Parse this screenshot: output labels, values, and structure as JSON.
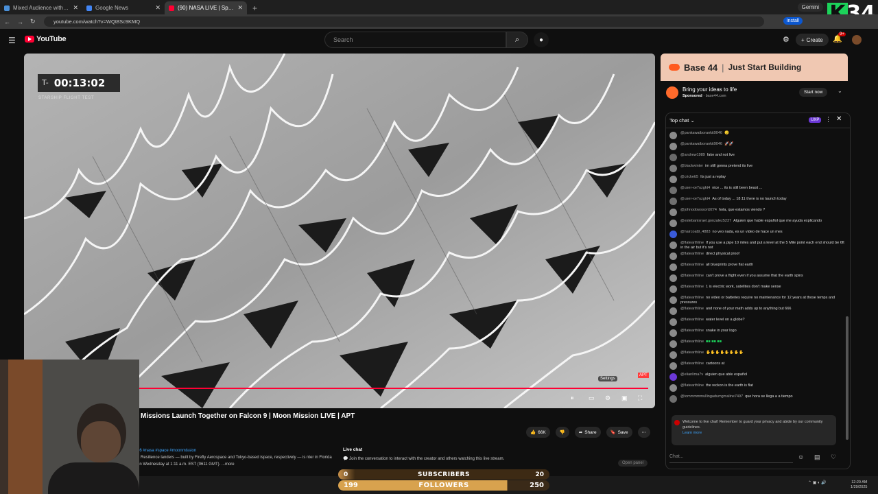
{
  "browser": {
    "tabs": [
      {
        "label": "Mixed Audience with Kathy Hu",
        "color": "#4a90d9",
        "active": false
      },
      {
        "label": "Google News",
        "color": "#4285f4",
        "active": false
      },
      {
        "label": "(90) NASA LIVE | SpaceX LIVE",
        "color": "#ff0033",
        "active": true
      }
    ],
    "new_tab": "+",
    "url": "youtube.com/watch?v=WQt8Sc9KMQ",
    "install_label": "Install",
    "gemini_label": "Gemini"
  },
  "overlay": {
    "k_letter": "K",
    "k_count": "34",
    "subscribers_label": "SUBSCRIBERS",
    "subscribers_current": "0",
    "subscribers_goal": "20",
    "followers_label": "FOLLOWERS",
    "followers_current": "199",
    "followers_goal": "250",
    "followers_progress": 0.796
  },
  "youtube": {
    "logo_text": "YouTube",
    "search_placeholder": "Search",
    "create_label": "Create",
    "notif_count": "9+"
  },
  "video": {
    "timer_prefix": "T-",
    "timer": "00:13:02",
    "subtitle": "STARSHIP FLIGHT TEST",
    "settings_label": "Settings",
    "apt_label": "APT",
    "title": "Missions Launch Together on Falcon 9 | Moon Mission LIVE | APT",
    "likes": "66K",
    "share_label": "Share",
    "save_label": "Save",
    "hashtags": "26 #nasa #space #moonmission",
    "description": "d Resilience landers — built by Firefly Aerospace and Tokyo-based ispace, respectively — is nter in Florida on Wednesday at 1:11 a.m. EST (0611 GMT). ...more"
  },
  "live_chat_info": {
    "heading": "Live chat",
    "text": "Join the conversation to interact with the creator and others watching this live stream.",
    "open_panel": "Open panel"
  },
  "ad": {
    "brand": "Base 44",
    "separator": "|",
    "slogan": "Just Start Building",
    "headline": "Bring your ideas to life",
    "sponsored": "Sponsored",
    "domain": "base44.com",
    "cta": "Start now"
  },
  "chat": {
    "title": "Top chat",
    "badge": "UXP",
    "messages": [
      {
        "author": "@pankawatborankit9046",
        "text": "",
        "emoji": "🙂",
        "emoji_type": "gold",
        "avatar": "#8a8a8a"
      },
      {
        "author": "@pankawatborankit9046",
        "text": "",
        "emoji": "🚀🚀",
        "emoji_type": "pink",
        "avatar": "#8a8a8a"
      },
      {
        "author": "@andrew1989",
        "text": "fake and not live",
        "emoji": "",
        "avatar": "#6a6a6a"
      },
      {
        "author": "@blackwinter",
        "text": "im still gonna pretend its live",
        "emoji": "",
        "avatar": "#7b7b7b"
      },
      {
        "author": "@crickett5",
        "text": "Its just a replay",
        "emoji": "",
        "avatar": "#8a8a8a"
      },
      {
        "author": "@user-xe7uzgkt4",
        "text": "nice ... its is still been beast ...",
        "emoji": "",
        "avatar": "#6f6f6f"
      },
      {
        "author": "@user-xe7uzgkt4",
        "text": "As of today ... 18:11 there is no launch today",
        "emoji": "",
        "avatar": "#6f6f6f"
      },
      {
        "author": "@johnodowsson9274",
        "text": "hola, que estamos viendo ?",
        "emoji": "",
        "avatar": "#8a8a8a"
      },
      {
        "author": "@estebanisrael.gonzalez5237",
        "text": "Alguien que hable español que me ayuda explicando",
        "emoji": "",
        "avatar": "#8a8a8a"
      },
      {
        "author": "@haircoat9_4883",
        "text": "no veo nada, es un video de hace un mes",
        "emoji": "",
        "avatar": "#3a5bd9"
      },
      {
        "author": "@flatearthline",
        "text": "If you use a pipe 10 miles and put a level at the 5 Mile point each end should be 6ft in the air but it's not",
        "emoji": "",
        "avatar": "#8a8a8a"
      },
      {
        "author": "@flatearthline",
        "text": "direct physical proof",
        "emoji": "",
        "avatar": "#8a8a8a"
      },
      {
        "author": "@flatearthline",
        "text": "all blueprints prove flat earth",
        "emoji": "",
        "avatar": "#8a8a8a"
      },
      {
        "author": "@flatearthline",
        "text": "can't prove a flight even if you assume that the earth spins",
        "emoji": "",
        "avatar": "#8a8a8a"
      },
      {
        "author": "@flatearthline",
        "text": "1 is electric work, satellites don't make sense",
        "emoji": "",
        "avatar": "#8a8a8a"
      },
      {
        "author": "@flatearthline",
        "text": "no video or batteries require no maintenance for 12 years at those temps and pressures",
        "emoji": "",
        "avatar": "#8a8a8a"
      },
      {
        "author": "@flatearthline",
        "text": "and none of your math adds up to anything but 666",
        "emoji": "",
        "avatar": "#8a8a8a"
      },
      {
        "author": "@flatearthline",
        "text": "water level on a globe?",
        "emoji": "",
        "avatar": "#8a8a8a"
      },
      {
        "author": "@flatearthline",
        "text": "snake in your logo",
        "emoji": "",
        "avatar": "#8a8a8a"
      },
      {
        "author": "@flatearthline",
        "text": "",
        "emoji": "■■ ■■ ■■",
        "emoji_type": "green",
        "avatar": "#8a8a8a"
      },
      {
        "author": "@flatearthline",
        "text": "",
        "emoji": "✋✋✋✋✋✋✋✋",
        "emoji_type": "gold",
        "avatar": "#8a8a8a"
      },
      {
        "author": "@flatearthline",
        "text": "cartoons at",
        "emoji": "",
        "avatar": "#8a8a8a"
      },
      {
        "author": "@elianlima7v",
        "text": "alguien que able español",
        "emoji": "",
        "avatar": "#6b38d6"
      },
      {
        "author": "@flatearthline",
        "text": "the reckon is the earth is flat",
        "emoji": "",
        "avatar": "#8a8a8a"
      },
      {
        "author": "@tommmmmullingadumgmaline7497",
        "text": "que hora se llega a a tiempo",
        "emoji": "",
        "avatar": "#6f6f6f"
      }
    ],
    "welcome_text": "Welcome to live chat! Remember to guard your privacy and abide by our community guidelines.",
    "learn_more": "Learn more",
    "input_placeholder": "Chat..."
  },
  "system": {
    "time": "12:20 AM",
    "date": "1/29/2025"
  }
}
